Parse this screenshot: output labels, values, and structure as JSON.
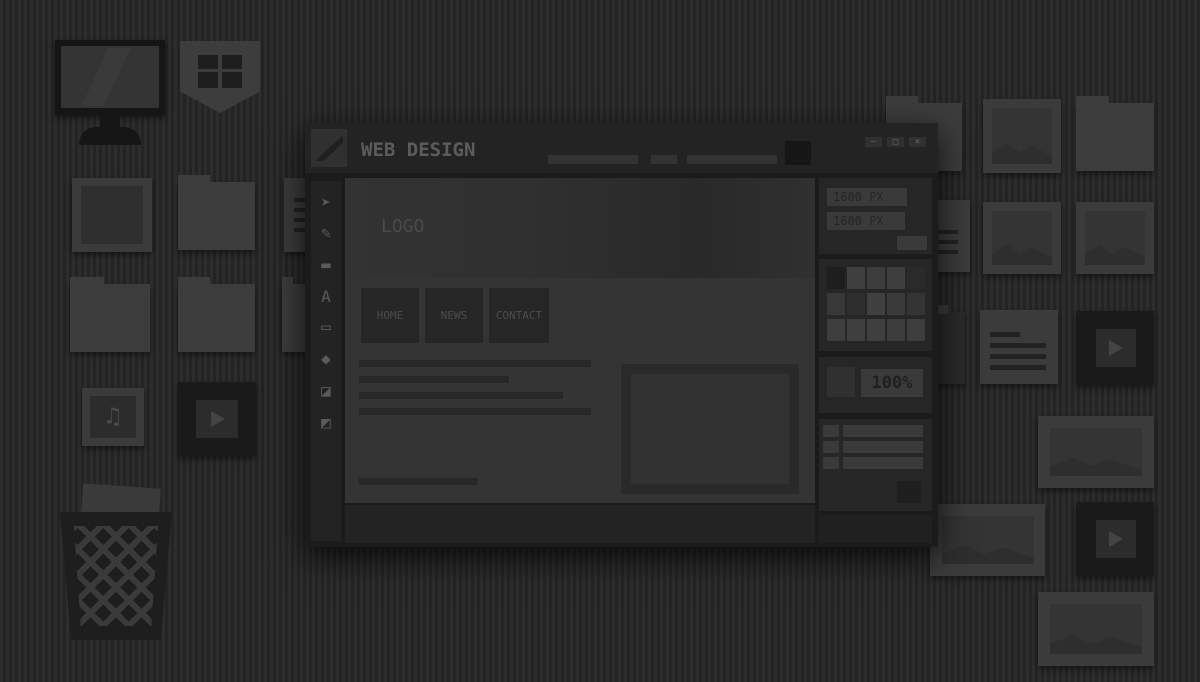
{
  "window": {
    "title": "WEB DESIGN",
    "controls": {
      "minimize": "—",
      "maximize": "□",
      "close": "✕"
    }
  },
  "tools": [
    {
      "name": "select-arrow-icon",
      "glyph": "➤"
    },
    {
      "name": "pencil-icon",
      "glyph": "✎"
    },
    {
      "name": "rectangle-fill-icon",
      "glyph": "▬"
    },
    {
      "name": "text-tool-icon",
      "glyph": "A"
    },
    {
      "name": "rectangle-outline-icon",
      "glyph": "▭"
    },
    {
      "name": "pen-nib-icon",
      "glyph": "◆"
    },
    {
      "name": "eraser-icon",
      "glyph": "◪"
    },
    {
      "name": "color-swap-icon",
      "glyph": "◩"
    }
  ],
  "canvas": {
    "logo": "LOGO",
    "nav": [
      "HOME",
      "NEWS",
      "CONTACT"
    ]
  },
  "properties": {
    "width_field": "1600 PX",
    "height_field": "1600 PX"
  },
  "swatches": [
    "#1e1e1e",
    "#404040",
    "#3c3c3c",
    "#3e3e3e",
    "#2a2a2a",
    "#383838",
    "#2e2e2e",
    "#404040",
    "#3a3a3a",
    "#343434",
    "#3e3e3e",
    "#404040",
    "#404040",
    "#3c3c3c",
    "#3e3e3e"
  ],
  "zoom": "100%",
  "desktop_icons": {
    "monitor": "monitor-icon",
    "shield": "shield-icon",
    "music": "music-file-icon",
    "video": "video-file-icon",
    "trash": "trash-bin-icon"
  }
}
